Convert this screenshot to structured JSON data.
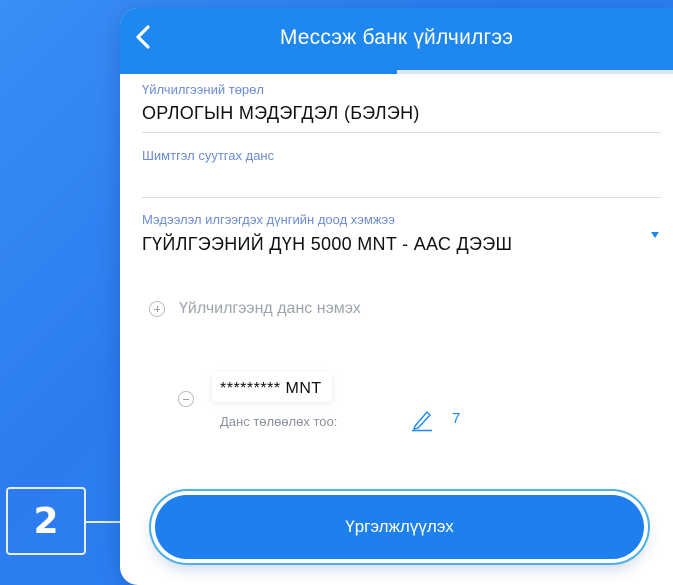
{
  "header": {
    "title": "Мессэж банк үйлчилгээ",
    "progress": 0.5
  },
  "form": {
    "service_type_label": "Үйлчилгээний төрөл",
    "service_type_value": "ОРЛОГЫН МЭДЭГДЭЛ (БЭЛЭН)",
    "fee_account_label": "Шимтгэл суутгах данс",
    "fee_account_value": "",
    "min_amount_label": "Мэдээлэл илгээгдэх дүнгийн доод хэмжээ",
    "min_amount_value": "ГҮЙЛГЭЭНИЙ ДҮН 5000 MNT - ААС ДЭЭШ"
  },
  "add_account": {
    "label": "Үйлчилгээнд данс нэмэх"
  },
  "account_item": {
    "account": "********* MNT",
    "payment_count_label": "Данс төлөөлөх тоо:",
    "payment_count": "7"
  },
  "continue_button": {
    "label": "Үргэлжлүүлэх"
  },
  "callout": {
    "number": "2"
  },
  "colors": {
    "accent": "#1e88f0",
    "label": "#6b8bd4",
    "background": "#2c7cf0"
  }
}
